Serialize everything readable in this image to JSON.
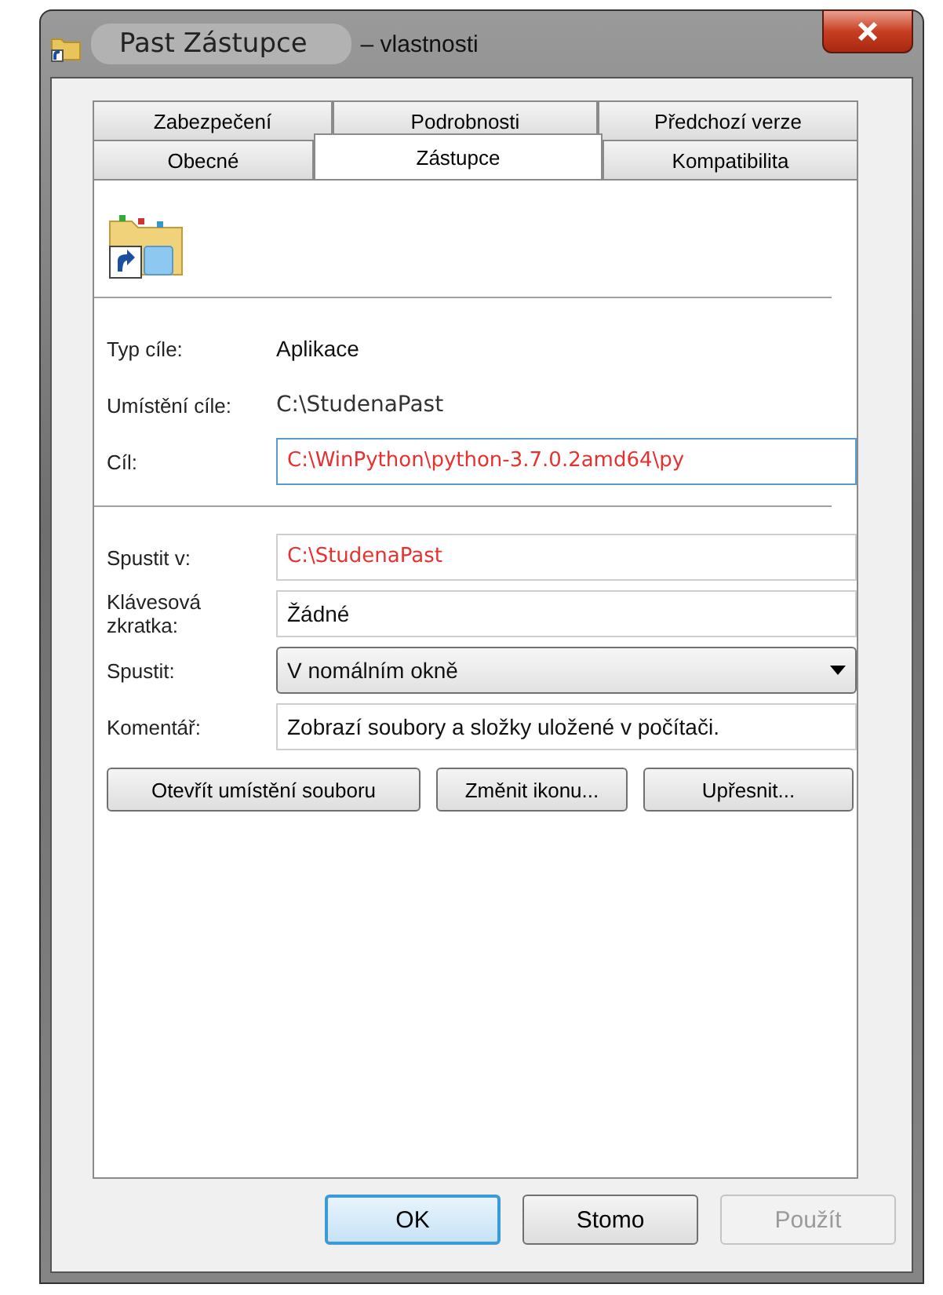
{
  "window": {
    "title": "Past Zástupce",
    "title_suffix": "– vlastnosti"
  },
  "tab_rows": [
    [
      {
        "label": "Zabezpečení",
        "selected": false
      },
      {
        "label": "Podrobnosti",
        "selected": false
      },
      {
        "label": "Předchozí verze",
        "selected": false
      }
    ],
    [
      {
        "label": "Obecné",
        "selected": false
      },
      {
        "label": "Zástupce",
        "selected": true
      },
      {
        "label": "Kompatibilita",
        "selected": false
      }
    ]
  ],
  "info": [
    {
      "label": "Typ cíle:",
      "value": "Aplikace",
      "kind": "text"
    },
    {
      "label": "Umístění cíle:",
      "value": "C:\\StudenaPast",
      "kind": "mono"
    }
  ],
  "target": {
    "label": "Cíl:",
    "value": "C:\\WinPython\\python-3.7.0.2amd64\\py"
  },
  "fields": [
    {
      "label": "Spustit v:",
      "value": "C:\\StudenaPast",
      "kind": "path"
    },
    {
      "label": "Klávesová zkratka:",
      "value": "Žádné",
      "kind": "text"
    },
    {
      "label": "Spustit:",
      "value": "V nomálním okně",
      "kind": "dropdown"
    },
    {
      "label": "Komentář:",
      "value": "Zobrazí soubory a složky uložené v počítači.",
      "kind": "text"
    }
  ],
  "actions": [
    "Otevřít umístění souboru",
    "Změnit ikonu...",
    "Upřesnit..."
  ],
  "buttons": [
    {
      "label": "OK",
      "kind": "default",
      "disabled": false
    },
    {
      "label": "Stomo",
      "kind": "normal",
      "disabled": false
    },
    {
      "label": "Použít",
      "kind": "normal",
      "disabled": true
    }
  ]
}
